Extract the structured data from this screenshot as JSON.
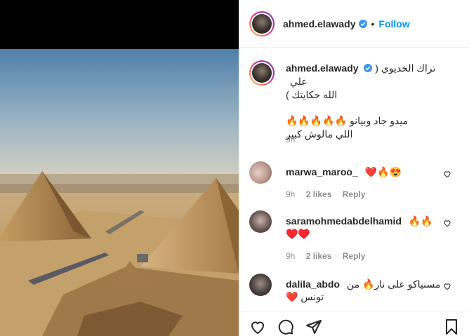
{
  "post": {
    "username": "ahmed.elawady",
    "follow_label": "Follow",
    "separator": "•"
  },
  "caption": {
    "username": "ahmed.elawady",
    "text_line1": "تراك الخديوي ( علي",
    "text_line2": "الله حكايتك )",
    "text_line3": "ميدو جاد وبيانو 🔥🔥🔥🔥🔥",
    "text_line4": "اللي مالوش كبير",
    "time": "9h"
  },
  "comments": [
    {
      "username": "marwa_maroo_",
      "text": "❤️🔥😍",
      "time": "9h",
      "likes": "2 likes",
      "reply": "Reply"
    },
    {
      "username": "saramohmedabdelhamid",
      "text": "🔥🔥",
      "text2": "♥️♥️",
      "time": "9h",
      "likes": "2 likes",
      "reply": "Reply"
    },
    {
      "username": "dalila_abdo",
      "text": "مسنياكو على نار🔥 من",
      "text2": "تونس ❤️"
    }
  ],
  "icons": [
    "verified-badge-icon",
    "heart-icon",
    "comment-icon",
    "share-icon",
    "bookmark-icon"
  ],
  "colors": {
    "accent": "#0095f6",
    "text": "#262626",
    "muted": "#8e8e8e",
    "border": "#efefef"
  }
}
